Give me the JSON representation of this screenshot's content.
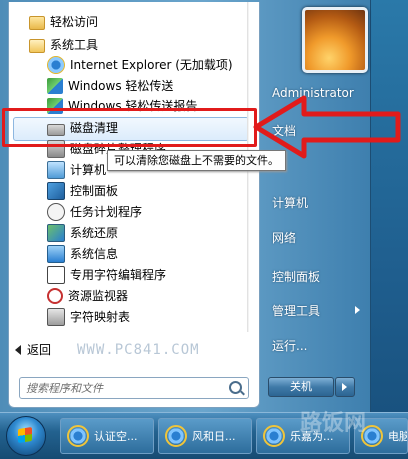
{
  "programs": {
    "items": [
      {
        "label": "轻松访问",
        "icon": "folder-icon"
      },
      {
        "label": "系统工具",
        "icon": "folder-open-icon"
      },
      {
        "label": "Internet Explorer (无加载项)",
        "icon": "internet-explorer-icon"
      },
      {
        "label": "Windows 轻松传送",
        "icon": "easy-transfer-icon"
      },
      {
        "label": "Windows 轻松传送报告",
        "icon": "transfer-report-icon"
      },
      {
        "label": "磁盘清理",
        "icon": "disk-cleanup-icon"
      },
      {
        "label": "磁盘碎片整理程序",
        "icon": "defrag-icon"
      },
      {
        "label": "计算机",
        "icon": "computer-icon"
      },
      {
        "label": "控制面板",
        "icon": "control-panel-icon"
      },
      {
        "label": "任务计划程序",
        "icon": "task-scheduler-icon"
      },
      {
        "label": "系统还原",
        "icon": "system-restore-icon"
      },
      {
        "label": "系统信息",
        "icon": "system-info-icon"
      },
      {
        "label": "专用字符编辑程序",
        "icon": "char-editor-icon"
      },
      {
        "label": "资源监视器",
        "icon": "resource-monitor-icon"
      },
      {
        "label": "字符映射表",
        "icon": "char-map-icon"
      }
    ],
    "selected": "磁盘清理"
  },
  "tooltip": "可以清除您磁盘上不需要的文件。",
  "back_label": "返回",
  "watermark": "WWW.PC841.COM",
  "search": {
    "placeholder": "搜索程序和文件"
  },
  "right": {
    "user": "Administrator",
    "items": [
      "文档",
      "计算机",
      "网络",
      "控制面板",
      "管理工具",
      "运行..."
    ],
    "shutdown_label": "关机"
  },
  "taskbar": {
    "tasks": [
      "认证空...",
      "风和日...",
      "乐嘉为...",
      "电脑"
    ]
  },
  "corner_watermark": "路饭网",
  "colors": {
    "annotation": "#e11b1b",
    "selection": "#dcecfc"
  }
}
